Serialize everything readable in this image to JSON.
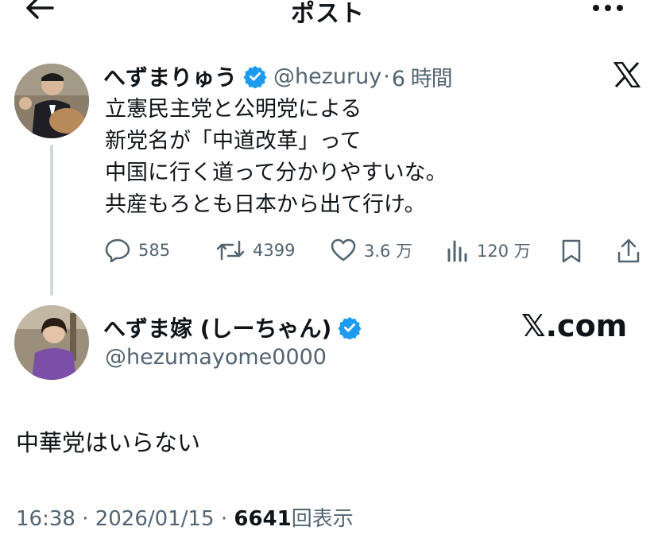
{
  "header": {
    "title": "ポスト"
  },
  "quoted_post": {
    "author_name": "へずまりゅう",
    "handle": "@hezuruy",
    "separator": "·",
    "time_ago": "6 時間",
    "text": "立憲民主党と公明党による\n新党名が「中道改革」って\n中国に行く道って分かりやすいな。\n共産もろとも日本から出て行け。",
    "actions": {
      "replies": "585",
      "reposts": "4399",
      "likes": "3.6 万",
      "views": "120 万"
    }
  },
  "reply_post": {
    "author_name": "へずま嫁 (しーちゃん)",
    "handle": "@hezumayome0000",
    "watermark": "𝕏.com",
    "text": "中華党はいらない",
    "timestamp": "16:38 · 2026/01/15 ·",
    "view_count": "6641",
    "view_label": "回表示"
  },
  "colors": {
    "verified": "#1d9bf0",
    "secondary_text": "#536471",
    "thread_line": "#cfd9de"
  },
  "icons": [
    "back-arrow-icon",
    "more-icon",
    "x-logo-icon",
    "verified-badge-icon",
    "reply-icon",
    "repost-icon",
    "like-icon",
    "views-icon",
    "bookmark-icon",
    "share-icon"
  ]
}
